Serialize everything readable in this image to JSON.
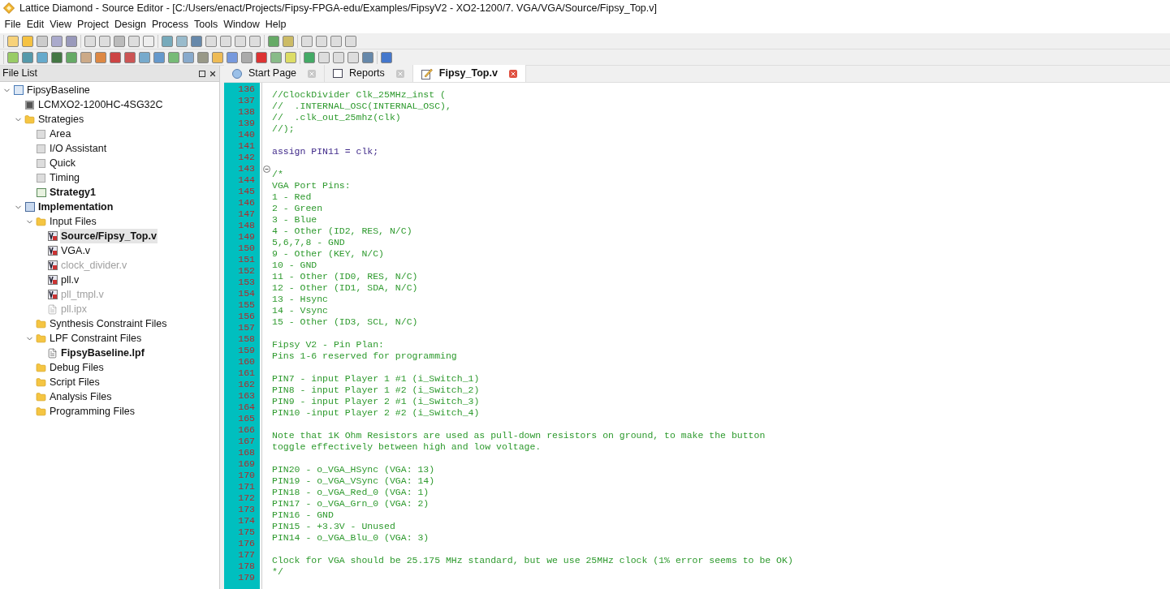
{
  "window": {
    "title": "Lattice Diamond - Source Editor - [C:/Users/enact/Projects/Fipsy-FPGA-edu/Examples/FipsyV2 - XO2-1200/7. VGA/VGA/Source/Fipsy_Top.v]"
  },
  "menu": [
    "File",
    "Edit",
    "View",
    "Project",
    "Design",
    "Process",
    "Tools",
    "Window",
    "Help"
  ],
  "file_list": {
    "title": "File List",
    "tree": [
      {
        "label": "FipsyBaseline",
        "kind": "project",
        "bold": false,
        "disabled": false,
        "selected": false,
        "expanded": true,
        "children": [
          {
            "label": "LCMXO2-1200HC-4SG32C",
            "kind": "device",
            "bold": false,
            "disabled": false,
            "selected": false
          },
          {
            "label": "Strategies",
            "kind": "folder",
            "bold": false,
            "disabled": false,
            "selected": false,
            "expanded": true,
            "children": [
              {
                "label": "Area",
                "kind": "strategy",
                "bold": false,
                "disabled": false,
                "selected": false
              },
              {
                "label": "I/O Assistant",
                "kind": "strategy",
                "bold": false,
                "disabled": false,
                "selected": false
              },
              {
                "label": "Quick",
                "kind": "strategy",
                "bold": false,
                "disabled": false,
                "selected": false
              },
              {
                "label": "Timing",
                "kind": "strategy",
                "bold": false,
                "disabled": false,
                "selected": false
              },
              {
                "label": "Strategy1",
                "kind": "active-strategy",
                "bold": true,
                "disabled": false,
                "selected": false
              }
            ]
          },
          {
            "label": "Implementation",
            "kind": "implementation",
            "bold": true,
            "disabled": false,
            "selected": false,
            "expanded": true,
            "children": [
              {
                "label": "Input Files",
                "kind": "folder",
                "bold": false,
                "disabled": false,
                "selected": false,
                "expanded": true,
                "children": [
                  {
                    "label": "Source/Fipsy_Top.v",
                    "kind": "verilog",
                    "bold": true,
                    "disabled": false,
                    "selected": true
                  },
                  {
                    "label": "VGA.v",
                    "kind": "verilog",
                    "bold": false,
                    "disabled": false,
                    "selected": false
                  },
                  {
                    "label": "clock_divider.v",
                    "kind": "verilog",
                    "bold": false,
                    "disabled": true,
                    "selected": false
                  },
                  {
                    "label": "pll.v",
                    "kind": "verilog",
                    "bold": false,
                    "disabled": false,
                    "selected": false
                  },
                  {
                    "label": "pll_tmpl.v",
                    "kind": "verilog",
                    "bold": false,
                    "disabled": true,
                    "selected": false
                  },
                  {
                    "label": "pll.ipx",
                    "kind": "file",
                    "bold": false,
                    "disabled": true,
                    "selected": false
                  }
                ]
              },
              {
                "label": "Synthesis Constraint Files",
                "kind": "folder",
                "bold": false,
                "disabled": false,
                "selected": false
              },
              {
                "label": "LPF Constraint Files",
                "kind": "folder",
                "bold": false,
                "disabled": false,
                "selected": false,
                "expanded": true,
                "children": [
                  {
                    "label": "FipsyBaseline.lpf",
                    "kind": "document",
                    "bold": true,
                    "disabled": false,
                    "selected": false
                  }
                ]
              },
              {
                "label": "Debug Files",
                "kind": "folder",
                "bold": false,
                "disabled": false,
                "selected": false
              },
              {
                "label": "Script Files",
                "kind": "folder",
                "bold": false,
                "disabled": false,
                "selected": false
              },
              {
                "label": "Analysis Files",
                "kind": "folder",
                "bold": false,
                "disabled": false,
                "selected": false
              },
              {
                "label": "Programming Files",
                "kind": "folder",
                "bold": false,
                "disabled": false,
                "selected": false
              }
            ]
          }
        ]
      }
    ]
  },
  "tabs": [
    {
      "label": "Start Page",
      "kind": "start",
      "selected": false
    },
    {
      "label": "Reports",
      "kind": "reports",
      "selected": false
    },
    {
      "label": "Fipsy_Top.v",
      "kind": "source",
      "selected": true
    }
  ],
  "editor": {
    "lines": [
      {
        "number": "136",
        "kind": "comment",
        "text": "//ClockDivider Clk_25MHz_inst ("
      },
      {
        "number": "137",
        "kind": "comment",
        "text": "//  .INTERNAL_OSC(INTERNAL_OSC),"
      },
      {
        "number": "138",
        "kind": "comment",
        "text": "//  .clk_out_25mhz(clk)"
      },
      {
        "number": "139",
        "kind": "comment",
        "text": "//);"
      },
      {
        "number": "140",
        "kind": "blank"
      },
      {
        "number": "141",
        "kind": "code",
        "text": "assign PIN11 = clk;"
      },
      {
        "number": "142",
        "kind": "blank"
      },
      {
        "number": "143",
        "kind": "comment",
        "fold": true,
        "text": "/*"
      },
      {
        "number": "144",
        "kind": "comment",
        "text": "VGA Port Pins:"
      },
      {
        "number": "145",
        "kind": "comment",
        "text": "1 - Red"
      },
      {
        "number": "146",
        "kind": "comment",
        "text": "2 - Green"
      },
      {
        "number": "147",
        "kind": "comment",
        "text": "3 - Blue"
      },
      {
        "number": "148",
        "kind": "comment",
        "text": "4 - Other (ID2, RES, N/C)"
      },
      {
        "number": "149",
        "kind": "comment",
        "text": "5,6,7,8 - GND"
      },
      {
        "number": "150",
        "kind": "comment",
        "text": "9 - Other (KEY, N/C)"
      },
      {
        "number": "151",
        "kind": "comment",
        "text": "10 - GND"
      },
      {
        "number": "152",
        "kind": "comment",
        "text": "11 - Other (ID0, RES, N/C)"
      },
      {
        "number": "153",
        "kind": "comment",
        "text": "12 - Other (ID1, SDA, N/C)"
      },
      {
        "number": "154",
        "kind": "comment",
        "text": "13 - Hsync"
      },
      {
        "number": "155",
        "kind": "comment",
        "text": "14 - Vsync"
      },
      {
        "number": "156",
        "kind": "comment",
        "text": "15 - Other (ID3, SCL, N/C)"
      },
      {
        "number": "157",
        "kind": "blank"
      },
      {
        "number": "158",
        "kind": "comment",
        "text": "Fipsy V2 - Pin Plan:"
      },
      {
        "number": "159",
        "kind": "comment",
        "text": "Pins 1-6 reserved for programming"
      },
      {
        "number": "160",
        "kind": "blank"
      },
      {
        "number": "161",
        "kind": "comment",
        "text": "PIN7 - input Player 1 #1 (i_Switch_1)"
      },
      {
        "number": "162",
        "kind": "comment",
        "text": "PIN8 - input Player 1 #2 (i_Switch_2)"
      },
      {
        "number": "163",
        "kind": "comment",
        "text": "PIN9 - input Player 2 #1 (i_Switch_3)"
      },
      {
        "number": "164",
        "kind": "comment",
        "text": "PIN10 -input Player 2 #2 (i_Switch_4)"
      },
      {
        "number": "165",
        "kind": "blank"
      },
      {
        "number": "166",
        "kind": "comment",
        "text": "Note that 1K Ohm Resistors are used as pull-down resistors on ground, to make the button"
      },
      {
        "number": "167",
        "kind": "comment",
        "text": "toggle effectively between high and low voltage."
      },
      {
        "number": "168",
        "kind": "blank"
      },
      {
        "number": "169",
        "kind": "comment",
        "text": "PIN20 - o_VGA_HSync (VGA: 13)"
      },
      {
        "number": "170",
        "kind": "comment",
        "text": "PIN19 - o_VGA_VSync (VGA: 14)"
      },
      {
        "number": "171",
        "kind": "comment",
        "text": "PIN18 - o_VGA_Red_0 (VGA: 1)"
      },
      {
        "number": "172",
        "kind": "comment",
        "text": "PIN17 - o_VGA_Grn_0 (VGA: 2)"
      },
      {
        "number": "173",
        "kind": "comment",
        "text": "PIN16 - GND"
      },
      {
        "number": "174",
        "kind": "comment",
        "text": "PIN15 - +3.3V - Unused"
      },
      {
        "number": "175",
        "kind": "comment",
        "text": "PIN14 - o_VGA_Blu_0 (VGA: 3)"
      },
      {
        "number": "176",
        "kind": "blank"
      },
      {
        "number": "177",
        "kind": "comment",
        "text": "Clock for VGA should be 25.175 MHz standard, but we use 25MHz clock (1% error seems to be OK)"
      },
      {
        "number": "178",
        "kind": "comment",
        "text": "*/"
      },
      {
        "number": "179",
        "kind": "blank"
      }
    ]
  }
}
